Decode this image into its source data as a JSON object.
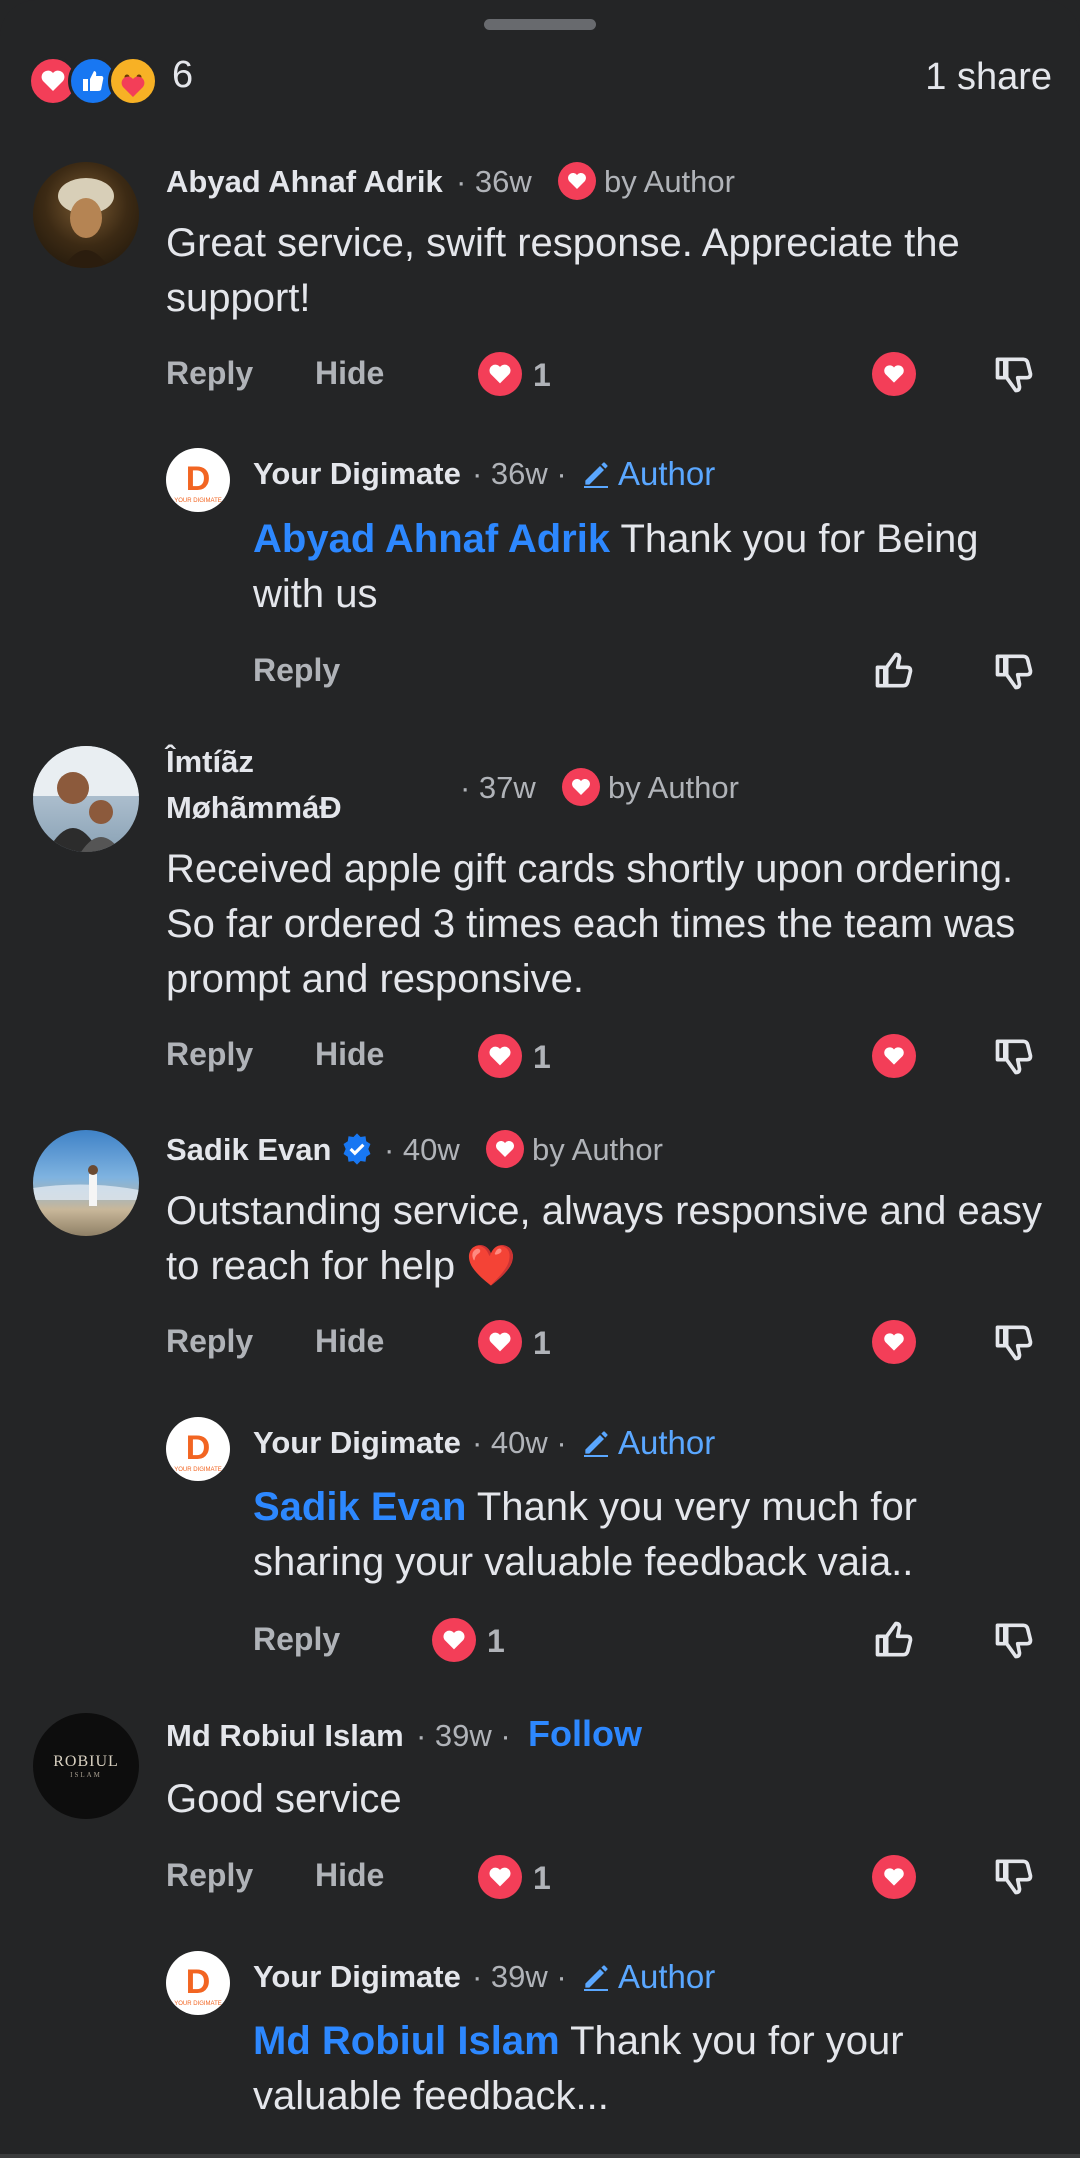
{
  "summary": {
    "reaction_count": "6",
    "share_count": "1 share",
    "reaction_icons": [
      "love-icon",
      "like-icon",
      "care-icon"
    ]
  },
  "comments": [
    {
      "name": "Abyad Ahnaf Adrik",
      "time": "· 36w",
      "badge": "by Author",
      "text": "Great service, swift response. Appreciate the support!",
      "reply": "Reply",
      "hide": "Hide",
      "reactions": "1"
    },
    {
      "name": "Your Digimate",
      "time": "· 36w ·",
      "author_tag": "Author",
      "mention": "Abyad Ahnaf Adrik",
      "text": "Thank you for Being with us",
      "reply": "Reply"
    },
    {
      "name_line1": "Îmtíãz",
      "name_line2": "MøhãmmáĐ",
      "time": "· 37w",
      "badge": "by Author",
      "text": "Received apple gift cards shortly upon ordering. So far ordered 3 times each times the team was prompt and responsive.",
      "reply": "Reply",
      "hide": "Hide",
      "reactions": "1"
    },
    {
      "name": "Sadik Evan",
      "time": "· 40w",
      "badge": "by Author",
      "text": "Outstanding service, always responsive and easy to reach for help",
      "emoji": "❤️",
      "reply": "Reply",
      "hide": "Hide",
      "reactions": "1"
    },
    {
      "name": "Your Digimate",
      "time": "· 40w ·",
      "author_tag": "Author",
      "mention": "Sadik Evan",
      "text": "Thank you very much for sharing your valuable feedback vaia..",
      "reply": "Reply",
      "reactions": "1"
    },
    {
      "name": "Md Robiul Islam",
      "time": "· 39w ·",
      "follow": "Follow",
      "avatar_text": "ROBIUL",
      "avatar_sub": "ISLAM",
      "text": "Good service",
      "reply": "Reply",
      "hide": "Hide",
      "reactions": "1"
    },
    {
      "name": "Your Digimate",
      "time": "· 39w ·",
      "author_tag": "Author",
      "mention": "Md Robiul Islam",
      "text": "Thank you for your valuable feedback..."
    }
  ],
  "digimate_logo": {
    "letter": "D",
    "caption": "YOUR DIGIMATE"
  },
  "colors": {
    "background": "#242526",
    "accent_blue": "#2d88ff",
    "love_red": "#f33e58",
    "text": "#e4e6eb",
    "muted": "#b0b3b8"
  }
}
